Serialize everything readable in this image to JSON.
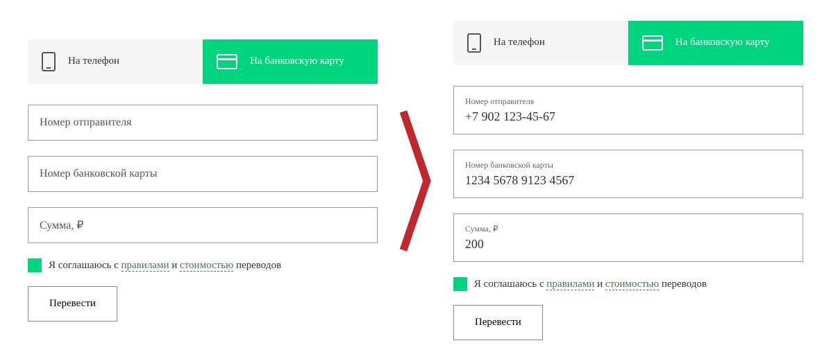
{
  "tabs": {
    "phone": "На телефон",
    "card": "На банковскую карту"
  },
  "left": {
    "sender_placeholder": "Номер отправителя",
    "card_placeholder": "Номер банковской карты",
    "amount_placeholder": "Сумма, ₽"
  },
  "right": {
    "sender_label": "Номер отправителя",
    "sender_value": "+7 902 123-45-67",
    "card_label": "Номер банковской карты",
    "card_value": "1234 5678 9123 4567",
    "amount_label": "Сумма, ₽",
    "amount_value": "200"
  },
  "agree": {
    "prefix": "Я соглашаюсь с ",
    "rules": "правилами",
    "and": " и ",
    "cost": "стоимостью",
    "suffix": " переводов"
  },
  "submit": "Перевести"
}
